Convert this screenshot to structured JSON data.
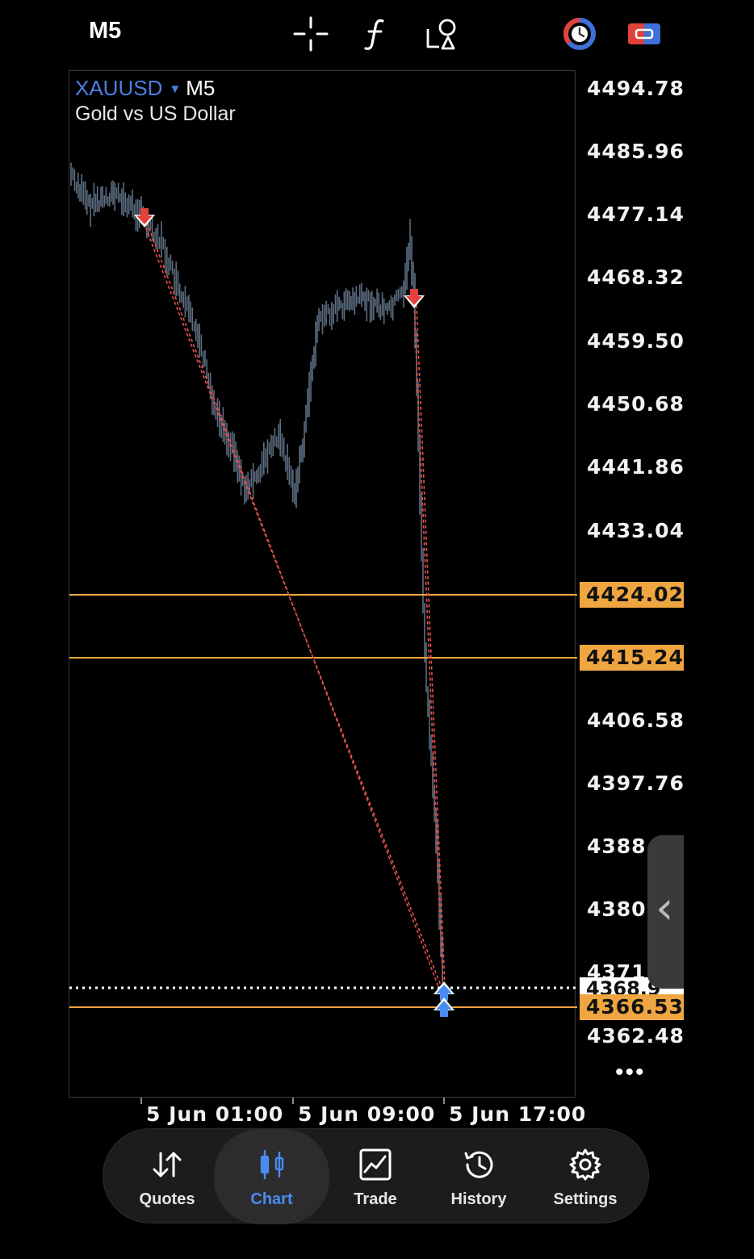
{
  "toolbar": {
    "timeframe": "M5",
    "icons": [
      "crosshair-icon",
      "indicators-f-icon",
      "objects-shapes-icon",
      "trading-clock-icon",
      "one-click-trading-icon"
    ]
  },
  "chart": {
    "symbol": "XAUUSD",
    "dropdown_marker": "▼",
    "timeframe": "M5",
    "description": "Gold vs US Dollar",
    "price_scale": [
      "4494.78",
      "4485.96",
      "4477.14",
      "4468.32",
      "4459.50",
      "4450.68",
      "4441.86",
      "4433.04",
      "4406.58",
      "4397.76",
      "4388.",
      "4380.",
      "4371",
      "4362.48"
    ],
    "level_tags": [
      "4424.02",
      "4415.24",
      "4366.53"
    ],
    "current_price_partial": "4368.9",
    "time_scale": [
      "5 Jun 01:00",
      "5 Jun 09:00",
      "5 Jun 17:00"
    ],
    "more_label": "•••",
    "drawer_handle": "‹",
    "colors": {
      "symbol": "#4a7fe0",
      "candles": "#5c6e82",
      "level_line": "#f0a640",
      "sell_marker": "#e0413a",
      "buy_marker": "#4a8bf0",
      "trade_line": "#e0524a"
    }
  },
  "nav": {
    "items": [
      {
        "label": "Quotes",
        "icon": "quotes-arrows-icon"
      },
      {
        "label": "Chart",
        "icon": "chart-candles-icon",
        "active": true
      },
      {
        "label": "Trade",
        "icon": "trade-chart-icon"
      },
      {
        "label": "History",
        "icon": "history-clock-icon"
      },
      {
        "label": "Settings",
        "icon": "settings-gear-icon"
      }
    ]
  }
}
